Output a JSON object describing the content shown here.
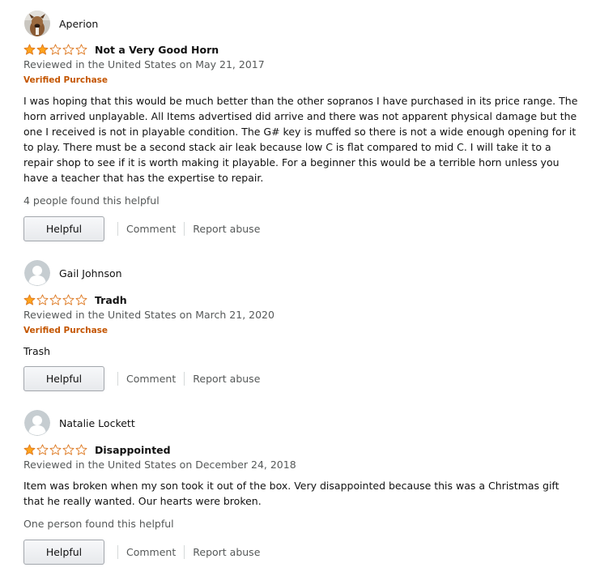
{
  "reviews": [
    {
      "name": "Aperion",
      "avatar": "dog-photo-avatar",
      "rating": 2,
      "title": "Not a Very Good Horn",
      "date": "Reviewed in the United States on May 21, 2017",
      "verified": "Verified Purchase",
      "body": "I was hoping that this would be much better than the other sopranos I have purchased in its price range. The horn arrived unplayable. All Items advertised did arrive and there was not apparent physical damage but the one I received is not in playable condition. The G# key is muffed so there is not a wide enough opening for it to play. There must be a second stack air leak because low C is flat compared to mid C. I will take it to a repair shop to see if it is worth making it playable. For a beginner this would be a terrible horn unless you have a teacher that has the expertise to repair.",
      "helpful_count": "4 people found this helpful",
      "helpful_label": "Helpful",
      "comment_label": "Comment",
      "report_label": "Report abuse"
    },
    {
      "name": "Gail Johnson",
      "avatar": "default-user-avatar",
      "rating": 1,
      "title": "Tradh",
      "date": "Reviewed in the United States on March 21, 2020",
      "verified": "Verified Purchase",
      "body": "Trash",
      "helpful_count": "",
      "helpful_label": "Helpful",
      "comment_label": "Comment",
      "report_label": "Report abuse"
    },
    {
      "name": "Natalie Lockett",
      "avatar": "default-user-avatar",
      "rating": 1,
      "title": "Disappointed",
      "date": "Reviewed in the United States on December 24, 2018",
      "verified": "",
      "body": "Item was broken when my son took it out of the box. Very disappointed because this was a Christmas gift that he really wanted. Our hearts were broken.",
      "helpful_count": "One person found this helpful",
      "helpful_label": "Helpful",
      "comment_label": "Comment",
      "report_label": "Report abuse"
    }
  ],
  "colors": {
    "star_fill": "#ffa41c",
    "star_outline": "#de7921",
    "verified": "#c45500",
    "secondary_text": "#565959"
  },
  "rating_scale": 5
}
